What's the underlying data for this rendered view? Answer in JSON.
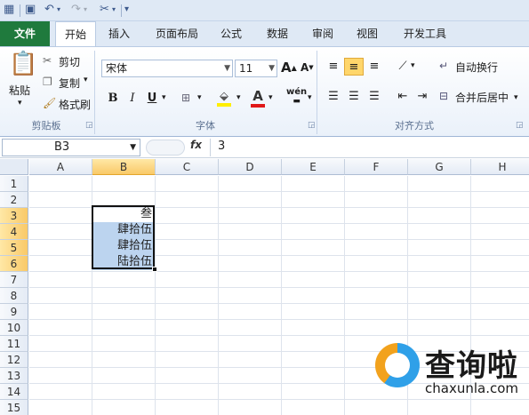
{
  "ribbon_tabs": {
    "file": "文件",
    "home": "开始",
    "insert": "插入",
    "page_layout": "页面布局",
    "formulas": "公式",
    "data": "数据",
    "review": "审阅",
    "view": "视图",
    "developer": "开发工具"
  },
  "clipboard": {
    "paste": "粘贴",
    "cut": "剪切",
    "copy": "复制",
    "format_painter": "格式刷",
    "label": "剪贴板"
  },
  "font": {
    "name": "宋体",
    "size": "11",
    "bold": "B",
    "italic": "I",
    "underline": "U",
    "font_color_glyph": "A",
    "wen_glyph": "wén",
    "label": "字体"
  },
  "alignment": {
    "wrap_text": "自动换行",
    "merge_center": "合并后居中",
    "label": "对齐方式"
  },
  "formula_bar": {
    "name_box": "B3",
    "fx": "fx",
    "value": "3"
  },
  "columns": [
    "A",
    "B",
    "C",
    "D",
    "E",
    "F",
    "G",
    "H"
  ],
  "rows": [
    "1",
    "2",
    "3",
    "4",
    "5",
    "6",
    "7",
    "8",
    "9",
    "10",
    "11",
    "12",
    "13",
    "14",
    "15"
  ],
  "cells": {
    "B3": "叁",
    "B4": "肆拾伍",
    "B5": "肆拾伍",
    "B6": "陆拾伍"
  },
  "watermark": {
    "title": "查询啦",
    "url": "chaxunla.com"
  },
  "colors": {
    "file_tab": "#1f7a3d",
    "selection_highlight": "#bcd4ef",
    "header_selected": "#f9c968"
  }
}
